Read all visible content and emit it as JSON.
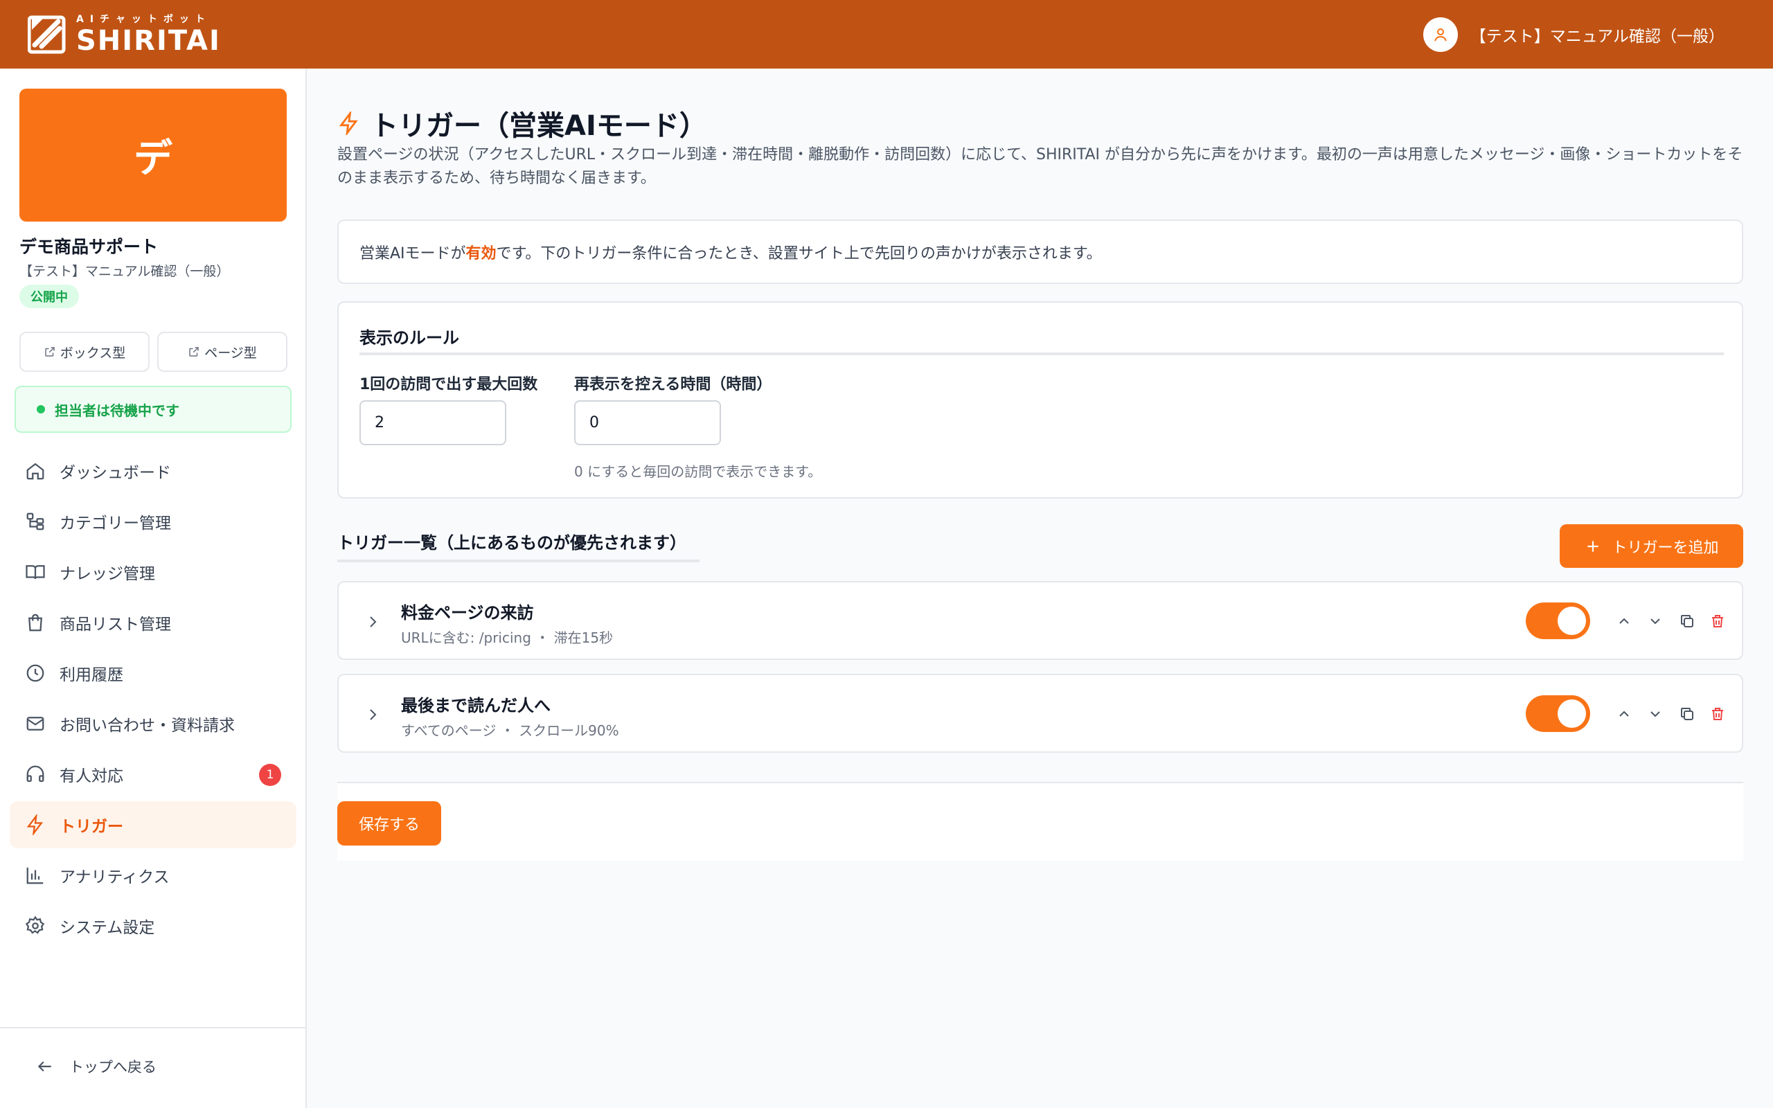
{
  "header": {
    "logo_sub": "AIチャットボット",
    "logo_main": "SHIRITAI",
    "user_name": "【テスト】マニュアル確認（一般）"
  },
  "sidebar": {
    "tile_letter": "デ",
    "project_name": "デモ商品サポート",
    "project_sub": "【テスト】マニュアル確認（一般）",
    "status_badge": "公開中",
    "box_view_label": "ボックス型",
    "page_view_label": "ページ型",
    "agent_status": "担当者は待機中です",
    "items": [
      {
        "label": "ダッシュボード",
        "icon": "home-icon"
      },
      {
        "label": "カテゴリー管理",
        "icon": "category-tree-icon"
      },
      {
        "label": "ナレッジ管理",
        "icon": "book-icon"
      },
      {
        "label": "商品リスト管理",
        "icon": "shopping-bag-icon"
      },
      {
        "label": "利用履歴",
        "icon": "clock-icon"
      },
      {
        "label": "お問い合わせ・資料請求",
        "icon": "mail-icon"
      },
      {
        "label": "有人対応",
        "icon": "headphones-icon",
        "badge": "1"
      },
      {
        "label": "トリガー",
        "icon": "lightning-icon",
        "active": true
      },
      {
        "label": "アナリティクス",
        "icon": "bar-chart-icon"
      },
      {
        "label": "システム設定",
        "icon": "gear-icon"
      }
    ],
    "back_label": "トップへ戻る"
  },
  "main": {
    "title": "トリガー（営業AIモード）",
    "description": "設置ページの状況（アクセスしたURL・スクロール到達・滞在時間・離脱動作・訪問回数）に応じて、SHIRITAI が自分から先に声をかけます。最初の一声は用意したメッセージ・画像・ショートカットをそのまま表示するため、待ち時間なく届きます。",
    "notice_prefix": "営業AIモードが",
    "notice_highlight": "有効",
    "notice_suffix": "です。下のトリガー条件に合ったとき、設置サイト上で先回りの声かけが表示されます。",
    "rules": {
      "title": "表示のルール",
      "max_label": "1回の訪問で出す最大回数",
      "max_value": "2",
      "cooldown_label": "再表示を控える時間（時間）",
      "cooldown_value": "0",
      "hint": "0 にすると毎回の訪問で表示できます。"
    },
    "list_title": "トリガー一覧（上にあるものが優先されます）",
    "add_button": "トリガーを追加",
    "triggers": [
      {
        "name": "料金ページの来訪",
        "meta": "URLに含む: /pricing ・ 滞在15秒",
        "enabled": true
      },
      {
        "name": "最後まで読んだ人へ",
        "meta": "すべてのページ ・ スクロール90%",
        "enabled": true
      }
    ],
    "save_button": "保存する"
  },
  "colors": {
    "header": "#c05314",
    "accent": "#f97316",
    "success": "#16a34a",
    "danger": "#ef4444"
  }
}
